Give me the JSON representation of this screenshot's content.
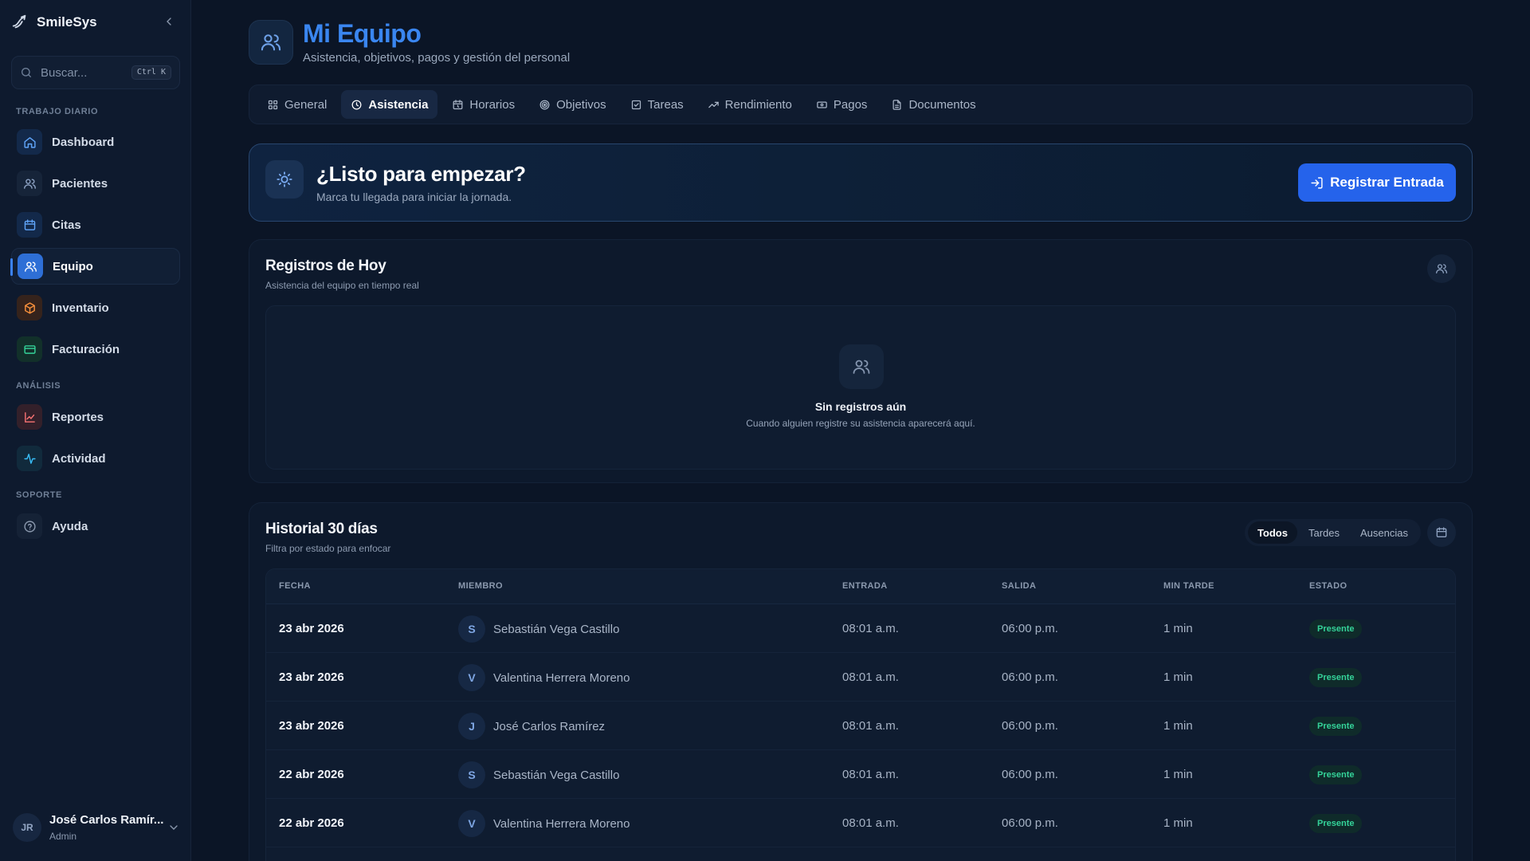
{
  "app": {
    "name": "SmileSys"
  },
  "search": {
    "placeholder": "Buscar...",
    "shortcut": "Ctrl K"
  },
  "sidebar": {
    "sections": [
      {
        "label": "TRABAJO DIARIO"
      },
      {
        "label": "ANÁLISIS"
      },
      {
        "label": "SOPORTE"
      }
    ],
    "items": [
      {
        "label": "Dashboard",
        "icon": "home-icon",
        "color": "#60a5fa",
        "bg": "#13294a"
      },
      {
        "label": "Pacientes",
        "icon": "users-icon",
        "color": "#8ea3c4",
        "bg": "#162439"
      },
      {
        "label": "Citas",
        "icon": "calendar-icon",
        "color": "#60a5fa",
        "bg": "#13294a"
      },
      {
        "label": "Equipo",
        "icon": "users-icon",
        "color": "#ffffff",
        "bg": "#2e6fd6"
      },
      {
        "label": "Inventario",
        "icon": "box-icon",
        "color": "#fb923c",
        "bg": "#35231c"
      },
      {
        "label": "Facturación",
        "icon": "credit-card-icon",
        "color": "#34d399",
        "bg": "#12302a"
      },
      {
        "label": "Reportes",
        "icon": "chart-icon",
        "color": "#f97373",
        "bg": "#33202a"
      },
      {
        "label": "Actividad",
        "icon": "activity-icon",
        "color": "#38bdf8",
        "bg": "#112a3c"
      },
      {
        "label": "Ayuda",
        "icon": "help-icon",
        "color": "#8a98ad",
        "bg": "#152236"
      }
    ]
  },
  "user": {
    "initials": "JR",
    "name": "José Carlos Ramír...",
    "role": "Admin"
  },
  "header": {
    "title": "Mi Equipo",
    "subtitle": "Asistencia, objetivos, pagos y gestión del personal"
  },
  "tabs": [
    {
      "label": "General",
      "icon": "grid-icon"
    },
    {
      "label": "Asistencia",
      "icon": "clock-icon"
    },
    {
      "label": "Horarios",
      "icon": "calendar-clock-icon"
    },
    {
      "label": "Objetivos",
      "icon": "target-icon"
    },
    {
      "label": "Tareas",
      "icon": "checkbox-icon"
    },
    {
      "label": "Rendimiento",
      "icon": "trending-up-icon"
    },
    {
      "label": "Pagos",
      "icon": "banknote-icon"
    },
    {
      "label": "Documentos",
      "icon": "document-icon"
    }
  ],
  "active_tab": "Asistencia",
  "hero": {
    "title": "¿Listo para empezar?",
    "subtitle": "Marca tu llegada para iniciar la jornada.",
    "button": "Registrar Entrada",
    "icon": "sun-icon"
  },
  "today": {
    "title": "Registros de Hoy",
    "subtitle": "Asistencia del equipo en tiempo real",
    "empty_title": "Sin registros aún",
    "empty_subtitle": "Cuando alguien registre su asistencia aparecerá aquí."
  },
  "history": {
    "title": "Historial 30 días",
    "subtitle": "Filtra por estado para enfocar",
    "filters": [
      "Todos",
      "Tardes",
      "Ausencias"
    ],
    "active_filter": "Todos",
    "columns": [
      "FECHA",
      "MIEMBRO",
      "ENTRADA",
      "SALIDA",
      "MIN TARDE",
      "ESTADO"
    ],
    "rows": [
      {
        "date": "23 abr 2026",
        "initial": "S",
        "member": "Sebastián Vega Castillo",
        "in": "08:01 a.m.",
        "out": "06:00 p.m.",
        "late": "1 min",
        "status": "Presente"
      },
      {
        "date": "23 abr 2026",
        "initial": "V",
        "member": "Valentina Herrera Moreno",
        "in": "08:01 a.m.",
        "out": "06:00 p.m.",
        "late": "1 min",
        "status": "Presente"
      },
      {
        "date": "23 abr 2026",
        "initial": "J",
        "member": "José Carlos Ramírez",
        "in": "08:01 a.m.",
        "out": "06:00 p.m.",
        "late": "1 min",
        "status": "Presente"
      },
      {
        "date": "22 abr 2026",
        "initial": "S",
        "member": "Sebastián Vega Castillo",
        "in": "08:01 a.m.",
        "out": "06:00 p.m.",
        "late": "1 min",
        "status": "Presente"
      },
      {
        "date": "22 abr 2026",
        "initial": "V",
        "member": "Valentina Herrera Moreno",
        "in": "08:01 a.m.",
        "out": "06:00 p.m.",
        "late": "1 min",
        "status": "Presente"
      }
    ]
  },
  "colors": {
    "accent": "#2563eb",
    "title": "#3a86f0",
    "success": "#34d399",
    "background": "#0b1526"
  }
}
